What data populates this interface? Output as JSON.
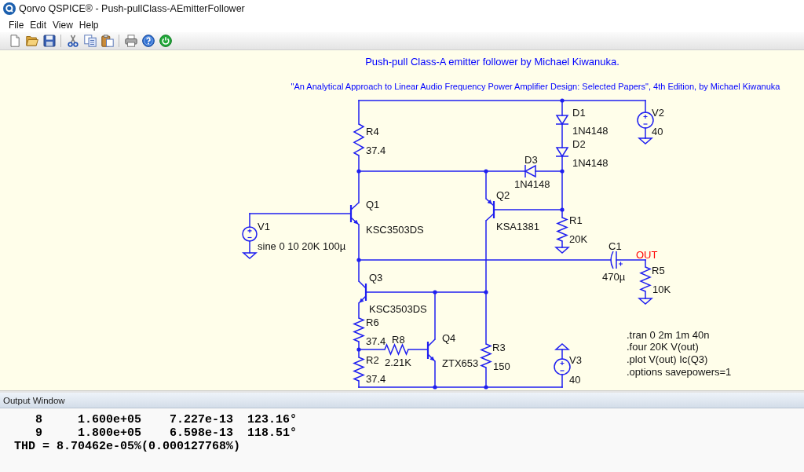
{
  "window": {
    "title": "Qorvo QSPICE® - Push-pullClass-AEmitterFollower"
  },
  "menu": [
    "File",
    "Edit",
    "View",
    "Help"
  ],
  "schematic": {
    "comments": [
      "Push-pull Class-A emitter follower by Michael Kiwanuka.",
      "\"An Analytical Approach to Linear Audio Frequency Power Amplifier Design: Selected Papers\", 4th Edition, by Michael Kiwanuka"
    ],
    "components": [
      {
        "kind": "resistor",
        "ref": "R4",
        "value": "37.4"
      },
      {
        "kind": "diode",
        "ref": "D1",
        "value": "1N4148"
      },
      {
        "kind": "source",
        "ref": "V2",
        "value": "40"
      },
      {
        "kind": "diode",
        "ref": "D2",
        "value": "1N4148"
      },
      {
        "kind": "diode",
        "ref": "D3",
        "value": "1N4148"
      },
      {
        "kind": "npn",
        "ref": "Q1",
        "value": "KSC3503DS"
      },
      {
        "kind": "pnp",
        "ref": "Q2",
        "value": "KSA1381"
      },
      {
        "kind": "resistor",
        "ref": "R1",
        "value": "20K"
      },
      {
        "kind": "source",
        "ref": "V1",
        "value": "sine 0 10 20K 100µ"
      },
      {
        "kind": "capacitor",
        "ref": "C1",
        "value": "470µ"
      },
      {
        "kind": "resistor",
        "ref": "R5",
        "value": "10K"
      },
      {
        "kind": "npn",
        "ref": "Q3",
        "value": "KSC3503DS"
      },
      {
        "kind": "resistor",
        "ref": "R6",
        "value": "37.4"
      },
      {
        "kind": "resistor",
        "ref": "R8",
        "value": "2.21K"
      },
      {
        "kind": "npn",
        "ref": "Q4",
        "value": "ZTX653"
      },
      {
        "kind": "resistor",
        "ref": "R3",
        "value": "150"
      },
      {
        "kind": "resistor",
        "ref": "R2",
        "value": "37.4"
      },
      {
        "kind": "source",
        "ref": "V3",
        "value": "40"
      }
    ],
    "net_labels": [
      "OUT"
    ],
    "directives": [
      ".tran 0 2m 1m 40n",
      ".four 20K V(out)",
      ".plot V(out) Ic(Q3)",
      ".options savepowers=1"
    ]
  },
  "output_window": {
    "title": "Output Window",
    "lines": [
      "    8     1.600e+05    7.227e-13  123.16°",
      "    9     1.800e+05    6.598e-13  118.51°",
      " THD = 8.70462e-05%(0.000127768%)"
    ]
  }
}
